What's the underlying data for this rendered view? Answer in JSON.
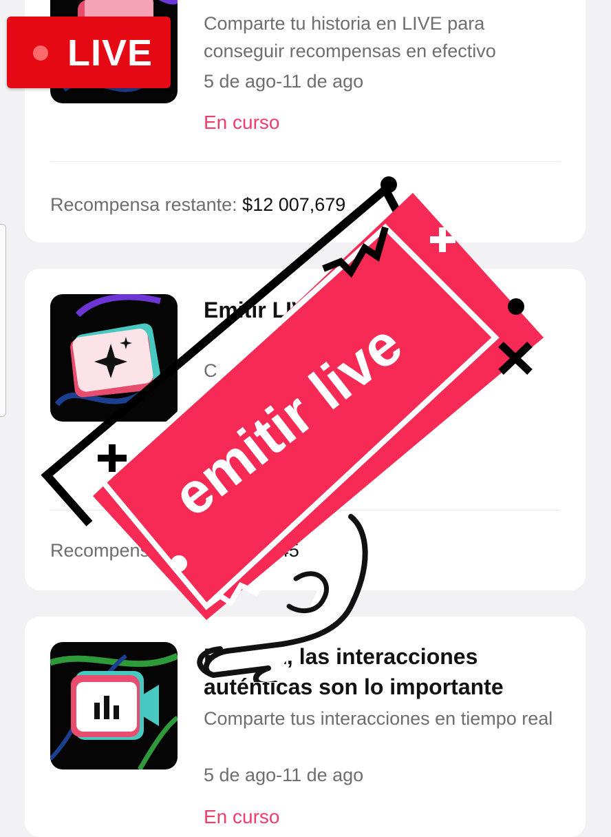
{
  "overlay": {
    "live_badge": "LIVE",
    "sticker_text": "emitir live"
  },
  "cards": [
    {
      "title": "",
      "description": "Comparte tu historia en LIVE para conseguir recompensas en efectivo",
      "date": "5 de ago-11 de ago",
      "status": "En curso",
      "reward_label": "Recompensa restante:",
      "reward_value": "$12 007,679"
    },
    {
      "title": "Emitir LIVE... ser d...",
      "description": "C... Lara",
      "reward_label": "Recompensa restante:",
      "reward_value": "$...245"
    },
    {
      "title": "En LIVE, las interacciones auténticas son lo importante",
      "description": "Comparte tus interacciones en tiempo real",
      "date": "5 de ago-11 de ago",
      "status": "En curso"
    }
  ],
  "colors": {
    "accent": "#ef3d6b",
    "sticker_red": "#f72a55",
    "live_red": "#e50914"
  },
  "icons": [
    "camera-icon",
    "sparkle-film-icon",
    "chart-video-icon",
    "pointing-hand-icon"
  ]
}
